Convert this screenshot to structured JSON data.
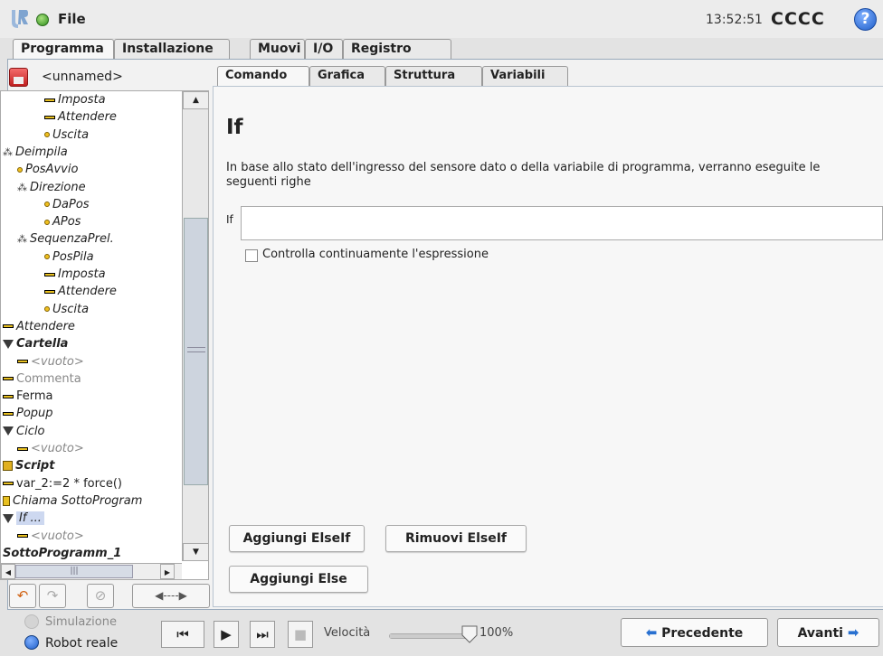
{
  "header": {
    "file_menu": "File",
    "clock": "13:52:51",
    "robot_name": "CCCC",
    "help": "?"
  },
  "main_tabs": [
    "Programma",
    "Installazione",
    "Muovi",
    "I/O",
    "Registro"
  ],
  "tree": {
    "filename": "<unnamed>",
    "items": [
      {
        "label": "Imposta",
        "icon": "bar",
        "indent": 2,
        "italic": true,
        "bold": false
      },
      {
        "label": "Attendere",
        "icon": "bar",
        "indent": 2,
        "italic": true,
        "bold": false
      },
      {
        "label": "Uscita",
        "icon": "dot",
        "indent": 2,
        "italic": true,
        "bold": false
      },
      {
        "label": "Deimpila",
        "icon": "node",
        "indent": 0,
        "italic": true,
        "bold": false
      },
      {
        "label": "PosAvvio",
        "icon": "dot",
        "indent": 1,
        "italic": true,
        "bold": false
      },
      {
        "label": "Direzione",
        "icon": "node",
        "indent": 1,
        "italic": true,
        "bold": false
      },
      {
        "label": "DaPos",
        "icon": "dot",
        "indent": 2,
        "italic": true,
        "bold": false
      },
      {
        "label": "APos",
        "icon": "dot",
        "indent": 2,
        "italic": true,
        "bold": false
      },
      {
        "label": "SequenzaPrel.",
        "icon": "node",
        "indent": 1,
        "italic": true,
        "bold": false
      },
      {
        "label": "PosPila",
        "icon": "dot",
        "indent": 2,
        "italic": true,
        "bold": false
      },
      {
        "label": "Imposta",
        "icon": "bar",
        "indent": 2,
        "italic": true,
        "bold": false
      },
      {
        "label": "Attendere",
        "icon": "bar",
        "indent": 2,
        "italic": true,
        "bold": false
      },
      {
        "label": "Uscita",
        "icon": "dot",
        "indent": 2,
        "italic": true,
        "bold": false
      },
      {
        "label": "Attendere",
        "icon": "bar",
        "indent": 0,
        "italic": true,
        "bold": false
      },
      {
        "label": "Cartella",
        "icon": "tri",
        "indent": 0,
        "italic": true,
        "bold": true
      },
      {
        "label": "<vuoto>",
        "icon": "bar",
        "indent": 1,
        "italic": true,
        "bold": false,
        "muted": true
      },
      {
        "label": "Commenta",
        "icon": "bar",
        "indent": 0,
        "italic": false,
        "bold": false,
        "muted": true
      },
      {
        "label": "Ferma",
        "icon": "bar",
        "indent": 0,
        "italic": false,
        "bold": false
      },
      {
        "label": "Popup",
        "icon": "bar",
        "indent": 0,
        "italic": true,
        "bold": false
      },
      {
        "label": "Ciclo",
        "icon": "tri",
        "indent": 0,
        "italic": true,
        "bold": false
      },
      {
        "label": "<vuoto>",
        "icon": "bar",
        "indent": 1,
        "italic": true,
        "bold": false,
        "muted": true
      },
      {
        "label": "Script",
        "icon": "sq",
        "indent": 0,
        "italic": true,
        "bold": true
      },
      {
        "label": "var_2:=2 * force()",
        "icon": "bar",
        "indent": 0,
        "italic": false,
        "bold": false
      },
      {
        "label": "Chiama SottoProgram",
        "icon": "flag",
        "indent": 0,
        "italic": true,
        "bold": false
      },
      {
        "label": "If ...",
        "icon": "tri",
        "indent": 0,
        "italic": true,
        "bold": false,
        "selected": true
      },
      {
        "label": "<vuoto>",
        "icon": "bar",
        "indent": 1,
        "italic": true,
        "bold": false,
        "muted": true
      },
      {
        "label": "SottoProgramm_1",
        "icon": "none",
        "indent": 0,
        "italic": true,
        "bold": true
      }
    ]
  },
  "cmd_tabs": [
    "Comando",
    "Grafica",
    "Struttura",
    "Variabili"
  ],
  "command": {
    "title": "If",
    "description": "In base allo stato dell'ingresso del sensore dato o della variabile di programma, verranno eseguite le seguenti righe",
    "if_label": "If",
    "if_value": "",
    "check_label": "Controlla continuamente l'espressione",
    "add_elseif": "Aggiungi ElseIf",
    "remove_elseif": "Rimuovi ElseIf",
    "add_else": "Aggiungi Else"
  },
  "bottom": {
    "sim_label": "Simulazione",
    "real_label": "Robot reale",
    "speed_label": "Velocità",
    "speed_value": "100%",
    "speed_fraction": 1.0,
    "prev_label": "Precedente",
    "next_label": "Avanti"
  }
}
